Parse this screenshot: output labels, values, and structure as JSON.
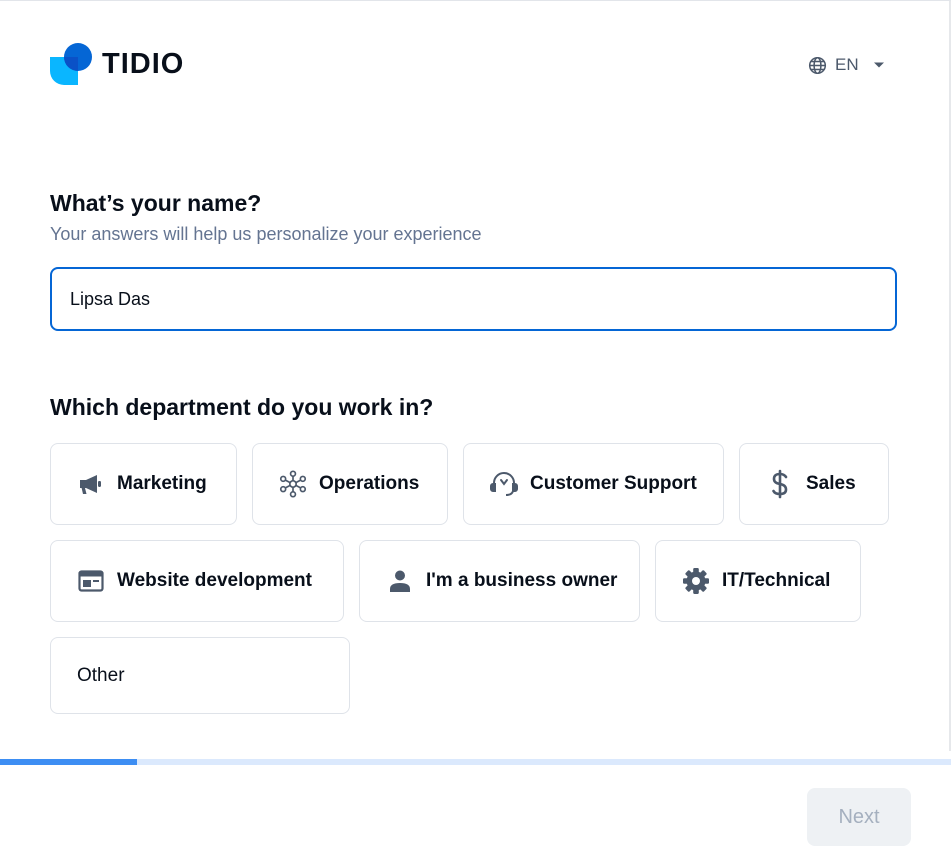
{
  "brand": {
    "name": "TIDIO"
  },
  "language": {
    "label": "EN"
  },
  "name_question": {
    "title": "What’s your name?",
    "subtitle": "Your answers will help us personalize your experience",
    "value": "Lipsa Das"
  },
  "department_question": {
    "title": "Which department do you work in?",
    "options": [
      {
        "label": "Marketing",
        "icon": "megaphone-icon"
      },
      {
        "label": "Operations",
        "icon": "network-icon"
      },
      {
        "label": "Customer Support",
        "icon": "headset-icon"
      },
      {
        "label": "Sales",
        "icon": "dollar-icon"
      },
      {
        "label": "Website development",
        "icon": "browser-window-icon"
      },
      {
        "label": "I'm a business owner",
        "icon": "person-icon"
      },
      {
        "label": "IT/Technical",
        "icon": "gear-icon"
      },
      {
        "label": "Other",
        "icon": ""
      }
    ]
  },
  "progress": {
    "fraction": 0.144
  },
  "footer": {
    "next_label": "Next"
  },
  "colors": {
    "accent": "#0566d5",
    "progress_fill": "#3d8ef3",
    "progress_track": "#dbe9fd",
    "icon": "#4c596b",
    "disabled_bg": "#eef1f4",
    "disabled_text": "#a5b0bf"
  }
}
